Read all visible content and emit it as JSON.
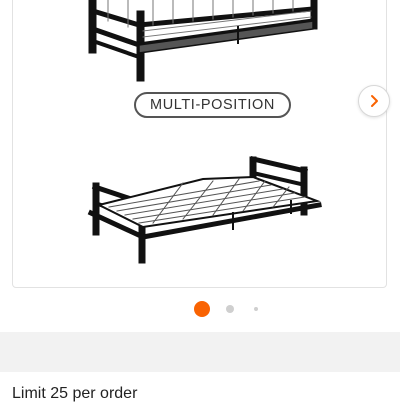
{
  "product_gallery": {
    "badge_label": "MULTI-POSITION",
    "next_icon": "chevron-right-icon",
    "accent_color": "#f96302",
    "pagination": {
      "count": 3,
      "active_index": 0
    }
  },
  "order_info": {
    "limit_text": "Limit 25 per order"
  }
}
